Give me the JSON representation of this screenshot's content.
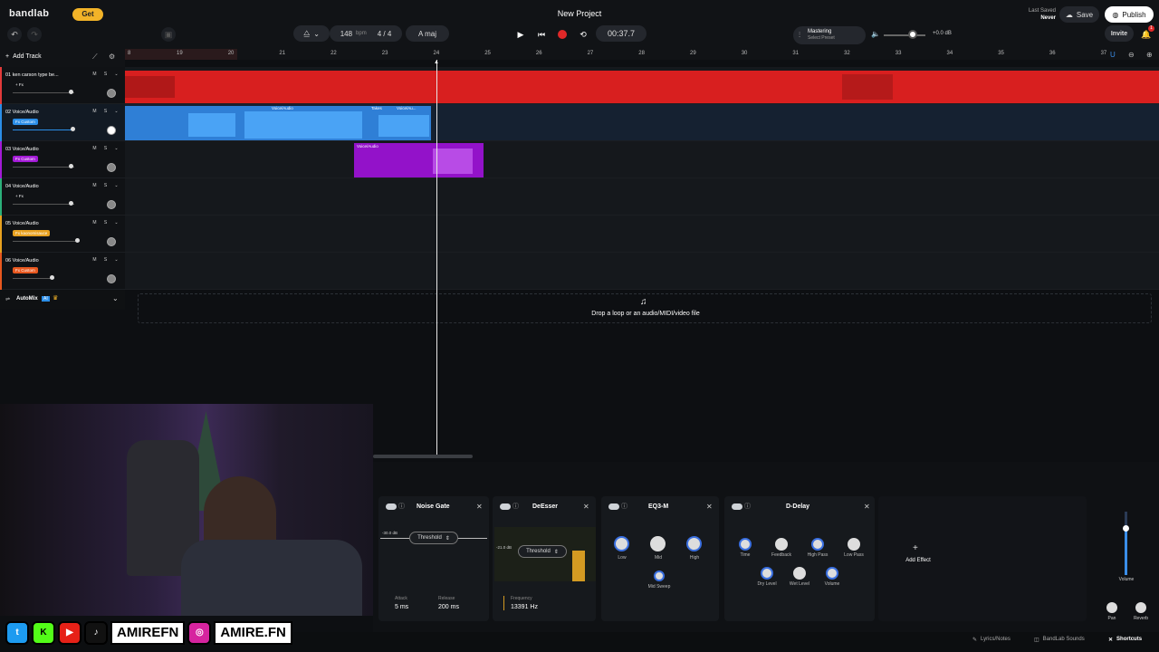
{
  "app": {
    "logo": "bandlab",
    "get_label": "Get",
    "project_title": "New Project",
    "last_saved_label": "Last Saved",
    "last_saved_value": "Never",
    "save_label": "Save",
    "publish_label": "Publish",
    "invite_label": "Invite",
    "notification_count": "1"
  },
  "transport": {
    "bpm_value": "148",
    "bpm_unit": "bpm",
    "time_signature": "4 / 4",
    "key": "A maj",
    "time": "00:37.7",
    "mastering_title": "Mastering",
    "mastering_preset": "Select Preset",
    "volume_db": "+0.0 dB"
  },
  "tracks": [
    {
      "name": "01  ken carson type be...",
      "fx": "+ Fx",
      "color": "#e23a3a"
    },
    {
      "name": "02  Voice/Audio",
      "fx": "Fx Custom",
      "color": "#2b8ee8"
    },
    {
      "name": "03  Voice/Audio",
      "fx": "Fx Custom",
      "color": "#a31ad6"
    },
    {
      "name": "04  Voice/Audio",
      "fx": "+ Fx",
      "color": "#2bb07a"
    },
    {
      "name": "05  Voice/Audio",
      "fx": "Fx kaonomisauce",
      "color": "#e8a120"
    },
    {
      "name": "06  Voice/Audio",
      "fx": "Fx Custom",
      "color": "#e8581f"
    }
  ],
  "track_controls": {
    "mute": "M",
    "solo": "S"
  },
  "add_track_label": "Add Track",
  "automix_label": "AutoMix",
  "automix_badge": "AI",
  "ruler_ticks": [
    "8",
    "19",
    "20",
    "21",
    "22",
    "23",
    "24",
    "25",
    "26",
    "27",
    "28",
    "29",
    "30",
    "31",
    "32",
    "33",
    "34",
    "35",
    "36",
    "37"
  ],
  "clips": {
    "voice_label": "Voice/Audio",
    "takes_label": "Takes",
    "voice_short": "Voice/Au..."
  },
  "drop_zone": "Drop a loop or an audio/MIDI/video file",
  "plugins": {
    "noise_gate": {
      "title": "Noise Gate",
      "db": "-30.0 dB",
      "threshold": "Threshold",
      "attack_label": "Attack",
      "attack_value": "5 ms",
      "release_label": "Release",
      "release_value": "200 ms"
    },
    "deesser": {
      "title": "DeEsser",
      "db": "-21.0 dB",
      "threshold": "Threshold",
      "freq_label": "Frequency",
      "freq_value": "13391 Hz"
    },
    "eq3": {
      "title": "EQ3-M",
      "low": "Low",
      "mid": "Mid",
      "high": "High",
      "mid_sweep": "Mid Sweep"
    },
    "ddelay": {
      "title": "D-Delay",
      "time": "Time",
      "feedback": "Feedback",
      "high_pass": "High Pass",
      "low_pass": "Low Pass",
      "dry": "Dry Level",
      "wet": "Wet Level",
      "volume": "Volume"
    },
    "add_effect": "Add Effect"
  },
  "master": {
    "volume": "Volume",
    "pan": "Pan",
    "reverb": "Reverb"
  },
  "bottom": {
    "lyrics": "Lyrics/Notes",
    "sounds": "BandLab Sounds",
    "shortcuts": "Shortcuts"
  },
  "social": {
    "handle1": "AMIREFN",
    "handle2": "AMIRE.FN"
  }
}
